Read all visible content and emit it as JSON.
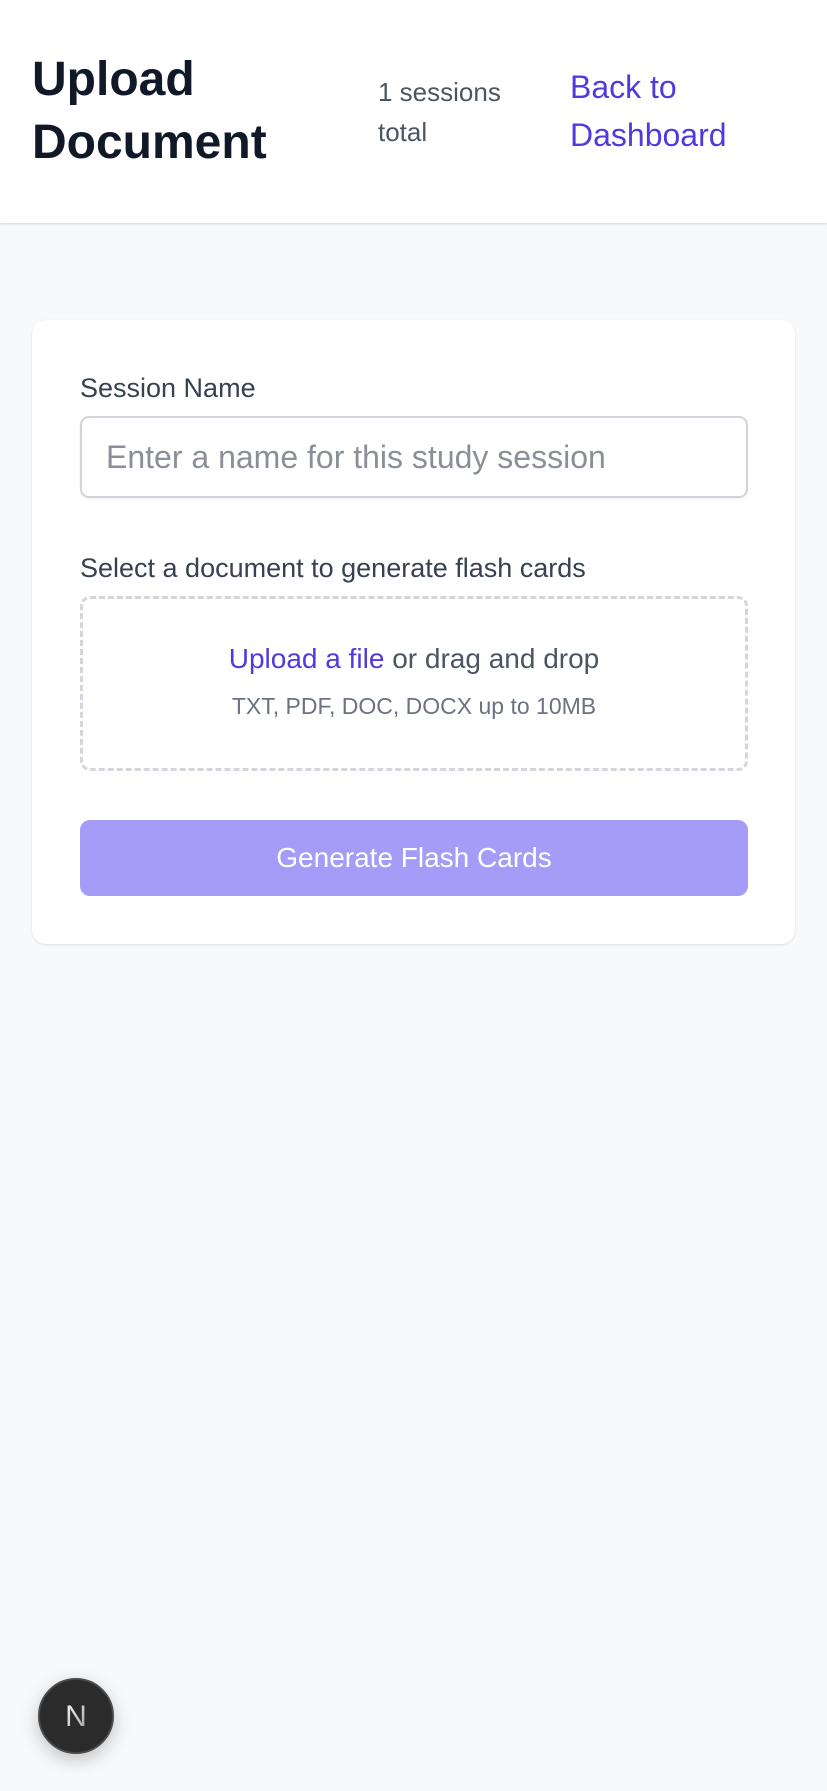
{
  "header": {
    "title": "Upload Document",
    "session_count": "1 sessions total",
    "back_link": "Back to Dashboard"
  },
  "form": {
    "session_label": "Session Name",
    "session_input": {
      "value": "",
      "placeholder": "Enter a name for this study session"
    },
    "document_label": "Select a document to generate flash cards",
    "dropzone": {
      "upload_link": "Upload a file",
      "drop_text": " or drag and drop",
      "hint": "TXT, PDF, DOC, DOCX up to 10MB"
    },
    "submit_label": "Generate Flash Cards"
  },
  "badge": {
    "icon": "nextjs-logo-icon",
    "letter": "N"
  },
  "colors": {
    "accent": "#4f3ae0",
    "button_disabled": "#a59cf7",
    "page_background": "#f8f9fb"
  }
}
